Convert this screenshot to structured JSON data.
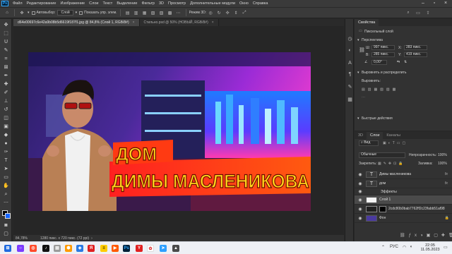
{
  "app": {
    "logo": "Ps",
    "menu": [
      "Файл",
      "Редактирование",
      "Изображение",
      "Слои",
      "Текст",
      "Выделение",
      "Фильтр",
      "3D",
      "Просмотр",
      "Дополнительные модули",
      "Окно",
      "Справка"
    ]
  },
  "options": {
    "autoselect_label": "Автовыбор:",
    "autoselect_value": "Слой",
    "show_controls_label": "Показать упр. элем.",
    "mode_3d_label": "Режим 3D:"
  },
  "tabs": [
    {
      "label": "d64e00697c6e42a9b08b5d6619f187f1.jpg @ 84,8% (Слой 1, RGB/8#)"
    },
    {
      "label": "Стильно.psd @ 50% (НОВЫЙ, RGB/8#)"
    }
  ],
  "artwork": {
    "line1": "ДОМ",
    "line2": "ДИМЫ МАСЛЕНИКОВА"
  },
  "status": {
    "zoom": "84,78%",
    "doc_info": "1280 пикс. x 720 пикс. (72 ppi)"
  },
  "properties": {
    "tabs": [
      "Свойства"
    ],
    "layer_kind": "Пиксельный слой",
    "transform_heading": "Перспектива",
    "w_label": "Ш:",
    "w_value": "997 пикс.",
    "x_label": "X:",
    "x_value": "283 пикс.",
    "h_label": "В:",
    "h_value": "285 пикс.",
    "y_label": "Y:",
    "y_value": "419 пикс.",
    "angle_value": "0,00°",
    "align_heading": "Выровнять и распределить",
    "align_label": "Выровнять:",
    "quick_heading": "Быстрые действия"
  },
  "layers": {
    "tabs": [
      "3D",
      "Слои",
      "Каналы"
    ],
    "kind_label": "Вид",
    "blend_mode": "Обычные",
    "opacity_label": "Непрозрачность:",
    "opacity_value": "100%",
    "lock_label": "Закрепить:",
    "fill_label": "Заливка:",
    "fill_value": "100%",
    "fx_label": "fx",
    "items": [
      {
        "name": "Димы масленикова"
      },
      {
        "name": "дом"
      },
      {
        "name": "Эффекты"
      },
      {
        "name": "Слой 1"
      },
      {
        "name": "2cdc80b0bab7762ff2c23fabb51af98e"
      },
      {
        "name": "Фон"
      }
    ]
  },
  "taskbar": {
    "time": "22:05",
    "date": "11.05.2023",
    "lang": "РУС"
  }
}
